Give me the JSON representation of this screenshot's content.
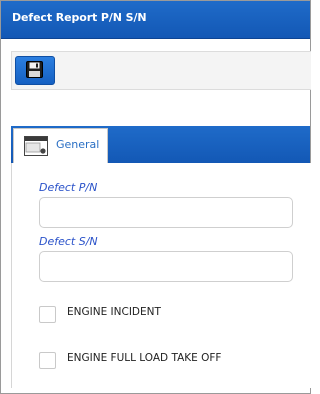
{
  "window": {
    "title": "Defect Report P/N S/N"
  },
  "toolbar": {
    "save_icon": "floppy-disk-icon"
  },
  "tabs": [
    {
      "label": "General",
      "icon": "window-icon"
    }
  ],
  "form": {
    "defect_pn": {
      "label": "Defect P/N",
      "value": ""
    },
    "defect_sn": {
      "label": "Defect S/N",
      "value": ""
    },
    "checkboxes": [
      {
        "label": "ENGINE INCIDENT",
        "checked": false
      },
      {
        "label": "ENGINE FULL LOAD TAKE OFF",
        "checked": false
      }
    ]
  },
  "colors": {
    "accent": "#1A63C4",
    "label_blue": "#2A52C9"
  }
}
